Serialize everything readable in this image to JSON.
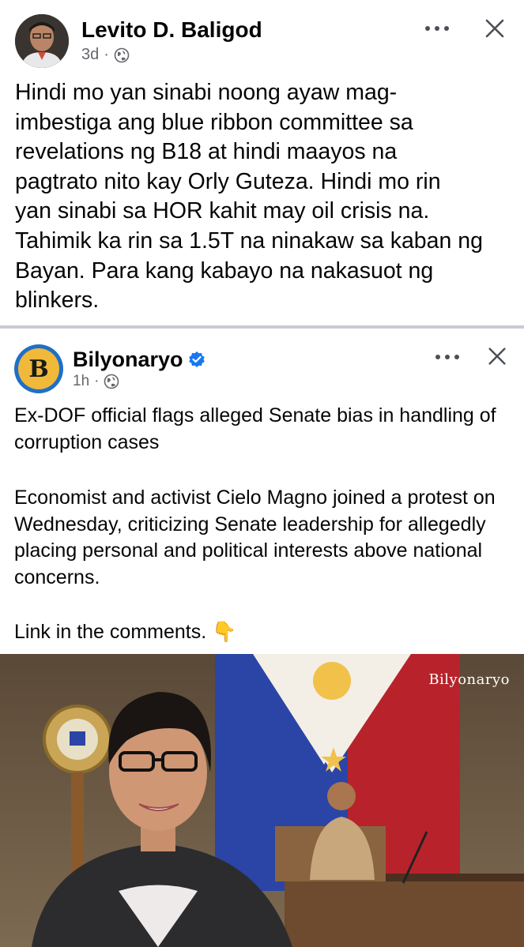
{
  "post1": {
    "author": "Levito D. Baligod",
    "time": "3d",
    "separator": "·",
    "text": "Hindi mo yan sinabi noong ayaw mag-\nimbestiga ang blue ribbon committee sa\nrevelations ng B18 at hindi maayos na\npagtrato nito kay Orly Guteza. Hindi mo rin\nyan sinabi sa HOR kahit may oil crisis na.\nTahimik ka rin sa 1.5T na ninakaw sa kaban ng\nBayan. Para kang kabayo na nakasuot ng\nblinkers."
  },
  "post2": {
    "author": "Bilyonaryo",
    "avatar_letter": "B",
    "time": "1h",
    "separator": "·",
    "headline": "Ex-DOF official flags alleged Senate bias in handling of corruption cases",
    "body": "Economist and activist Cielo Magno joined a protest on Wednesday, criticizing Senate leadership for allegedly placing personal and political interests above national concerns.",
    "link_text": "Link in the comments. 👇",
    "watermark": "Bilyonaryo"
  },
  "icons": {
    "more": "more-horizontal-icon",
    "close": "close-icon",
    "audience": "globe-icon",
    "verified": "verified-badge-icon"
  },
  "colors": {
    "text": "#050505",
    "meta": "#65676b",
    "verified": "#1877f2",
    "divider": "#c9ccd1"
  }
}
